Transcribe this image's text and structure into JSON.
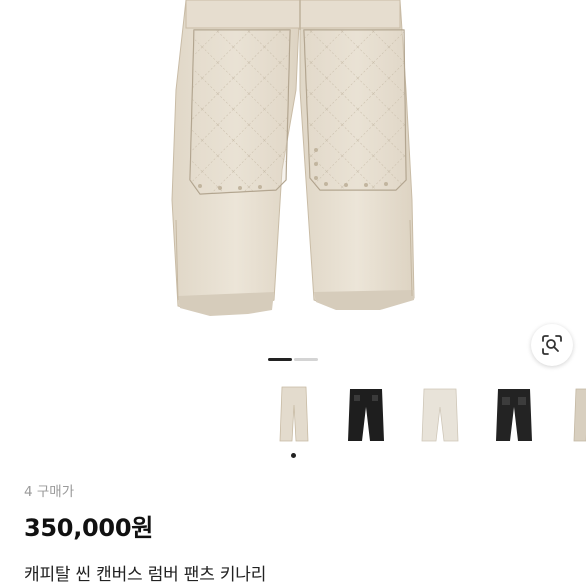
{
  "listing": {
    "purchase_count": "4",
    "purchase_label": "구매가",
    "price": "350,000원",
    "title": "캐피탈 씬 캔버스 럼버 팬츠 키나리"
  },
  "gallery": {
    "active_index": 1,
    "total_pages": 2,
    "thumbnails": [
      {
        "color": "cream",
        "hex": "#e3dbcd",
        "selected": true
      },
      {
        "color": "black",
        "hex": "#1e1e1e",
        "selected": false
      },
      {
        "color": "cream",
        "hex": "#e8e3d9",
        "selected": false
      },
      {
        "color": "black",
        "hex": "#232323",
        "selected": false
      },
      {
        "color": "beige",
        "hex": "#d8cfbf",
        "selected": false
      }
    ]
  },
  "icons": {
    "lens": "visual-search-icon"
  }
}
